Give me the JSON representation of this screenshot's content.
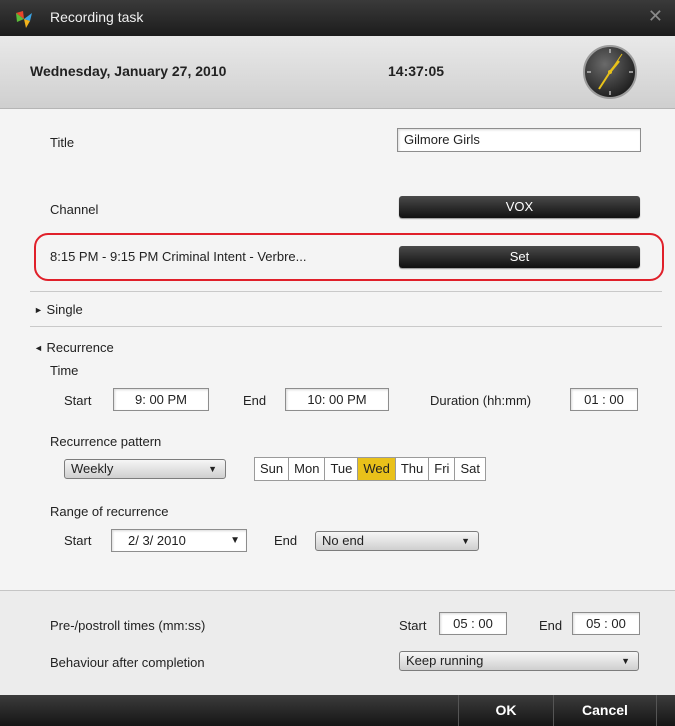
{
  "window": {
    "title": "Recording task",
    "close_glyph": "✕"
  },
  "header": {
    "date": "Wednesday, January 27, 2010",
    "time": "14:37:05"
  },
  "title_row": {
    "label": "Title",
    "value": "Gilmore Girls"
  },
  "channel_row": {
    "label": "Channel",
    "value": "VOX"
  },
  "program_row": {
    "text": "8:15 PM - 9:15 PM   Criminal Intent - Verbre...",
    "button": "Set"
  },
  "single": {
    "label": "Single",
    "expander": "►"
  },
  "recurrence": {
    "label": "Recurrence",
    "expander": "◄",
    "time_label": "Time",
    "start_label": "Start",
    "start_value": "9: 00  PM",
    "end_label": "End",
    "end_value": "10: 00  PM",
    "duration_label": "Duration (hh:mm)",
    "duration_value": "01 : 00",
    "pattern_label": "Recurrence pattern",
    "pattern_value": "Weekly",
    "days": [
      "Sun",
      "Mon",
      "Tue",
      "Wed",
      "Thu",
      "Fri",
      "Sat"
    ],
    "selected_day": "Wed",
    "range_label": "Range of recurrence",
    "range_start_label": "Start",
    "range_start_value": "2/  3/ 2010",
    "range_end_label": "End",
    "range_end_value": "No end"
  },
  "prepost": {
    "label": "Pre-/postroll times (mm:ss)",
    "start_label": "Start",
    "start_value": "05 : 00",
    "end_label": "End",
    "end_value": "05 : 00"
  },
  "behaviour": {
    "label": "Behaviour after completion",
    "value": "Keep running"
  },
  "buttons": {
    "ok": "OK",
    "cancel": "Cancel"
  },
  "colors": {
    "highlight_ring": "#e0202a",
    "selected_day": "#e9c11a",
    "titlebar": "#1c1c1c"
  }
}
